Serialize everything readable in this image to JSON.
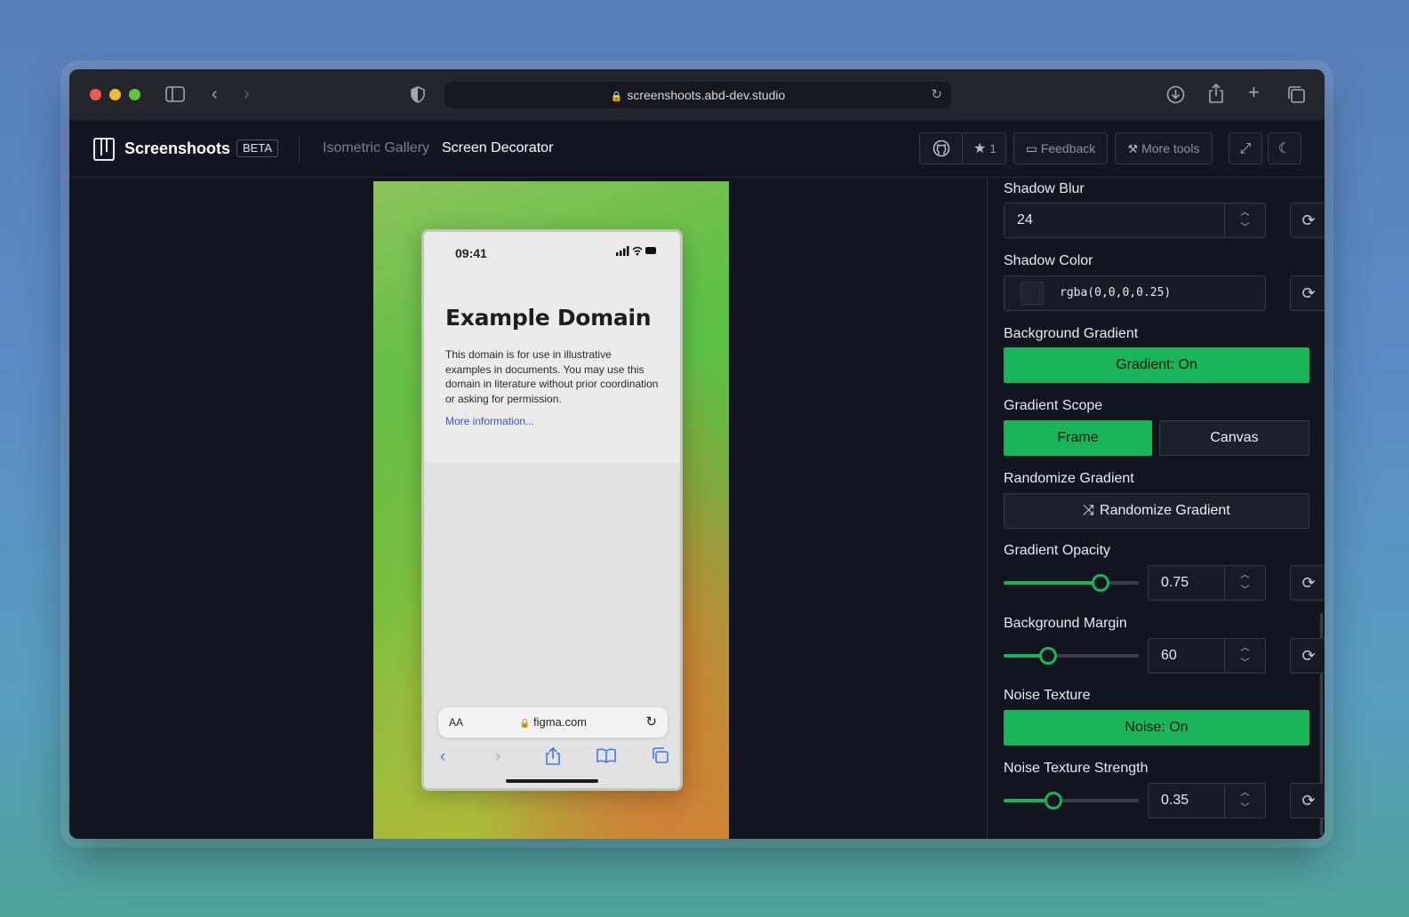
{
  "browser": {
    "url": "screenshoots.abd-dev.studio",
    "icons": [
      "sidebar-icon",
      "back-icon",
      "forward-icon",
      "shield-icon",
      "reload-icon",
      "download-icon",
      "share-icon",
      "new-tab-icon",
      "tabs-icon"
    ]
  },
  "app": {
    "brand": "Screenshoots",
    "badge": "BETA",
    "nav": [
      "Isometric Gallery",
      "Screen Decorator"
    ],
    "header_buttons": {
      "star_count": "1",
      "feedback": "Feedback",
      "more_tools": "More tools"
    }
  },
  "preview": {
    "phone": {
      "time": "09:41",
      "heading": "Example Domain",
      "paragraph": "This domain is for use in illustrative examples in documents. You may use this domain in literature without prior coordination or asking for permission.",
      "link": "More information...",
      "aa": "AA",
      "address": "figma.com"
    }
  },
  "panel": {
    "shadow_blur": {
      "label": "Shadow Blur",
      "value": "24"
    },
    "shadow_color": {
      "label": "Shadow Color",
      "value": "rgba(0,0,0,0.25)"
    },
    "background_gradient": {
      "label": "Background Gradient",
      "button": "Gradient: On"
    },
    "gradient_scope": {
      "label": "Gradient Scope",
      "options": [
        "Frame",
        "Canvas"
      ],
      "selected": "Frame"
    },
    "randomize_gradient": {
      "label": "Randomize Gradient",
      "button": "Randomize Gradient"
    },
    "gradient_opacity": {
      "label": "Gradient Opacity",
      "value": "0.75",
      "slider_fraction": 0.72
    },
    "background_margin": {
      "label": "Background Margin",
      "value": "60",
      "slider_fraction": 0.33
    },
    "noise_texture": {
      "label": "Noise Texture",
      "button": "Noise: On"
    },
    "noise_texture_strength": {
      "label": "Noise Texture Strength",
      "value": "0.35",
      "slider_fraction": 0.37
    }
  },
  "colors": {
    "accent": "#1ab45a",
    "panel_bg": "#121520",
    "titlebar": "#24262c"
  }
}
